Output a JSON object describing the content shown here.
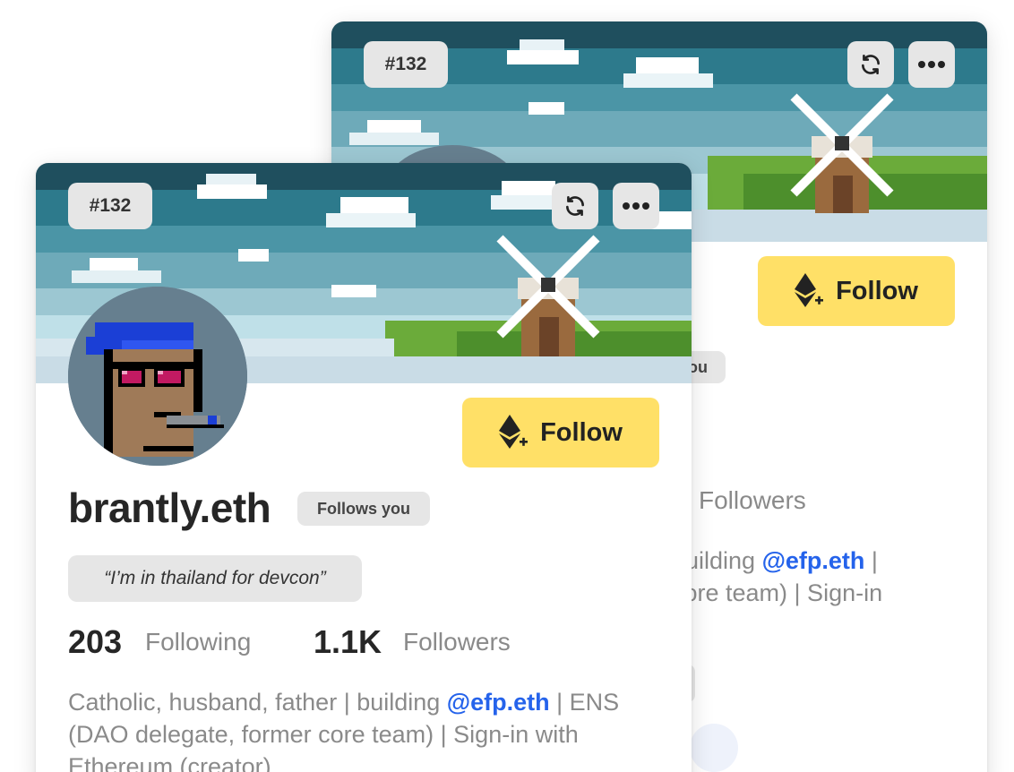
{
  "profile": {
    "rank": "#132",
    "name": "brantly.eth",
    "follows_you": "Follows you",
    "status": "“I’m in thailand for devcon”",
    "following_count": "203",
    "following_label": "Following",
    "followers_count": "1.1K",
    "followers_label": "Followers",
    "bio_part1": "Catholic, husband, father | building ",
    "bio_mention": "@efp.eth",
    "bio_part2": " | ENS (DAO delegate, former core team) | Sign-in with Ethereum (creator)",
    "follow_label": "Follow"
  },
  "back_card": {
    "rank": "#132",
    "follow_label": "Follow",
    "follows_fragment": "ou",
    "followers_label": "Followers",
    "bio_line1_pre": "building ",
    "bio_mention": "@efp.eth",
    "bio_line1_post": " |",
    "bio_line2": "core team) | Sign-in"
  },
  "icons": {
    "refresh": "refresh-icon",
    "more": "more-icon",
    "follow": "ethereum-plus-icon"
  },
  "colors": {
    "follow_button": "#ffe067",
    "badge": "#e6e6e6",
    "mention": "#2563eb",
    "muted_text": "#8a8a8a"
  }
}
